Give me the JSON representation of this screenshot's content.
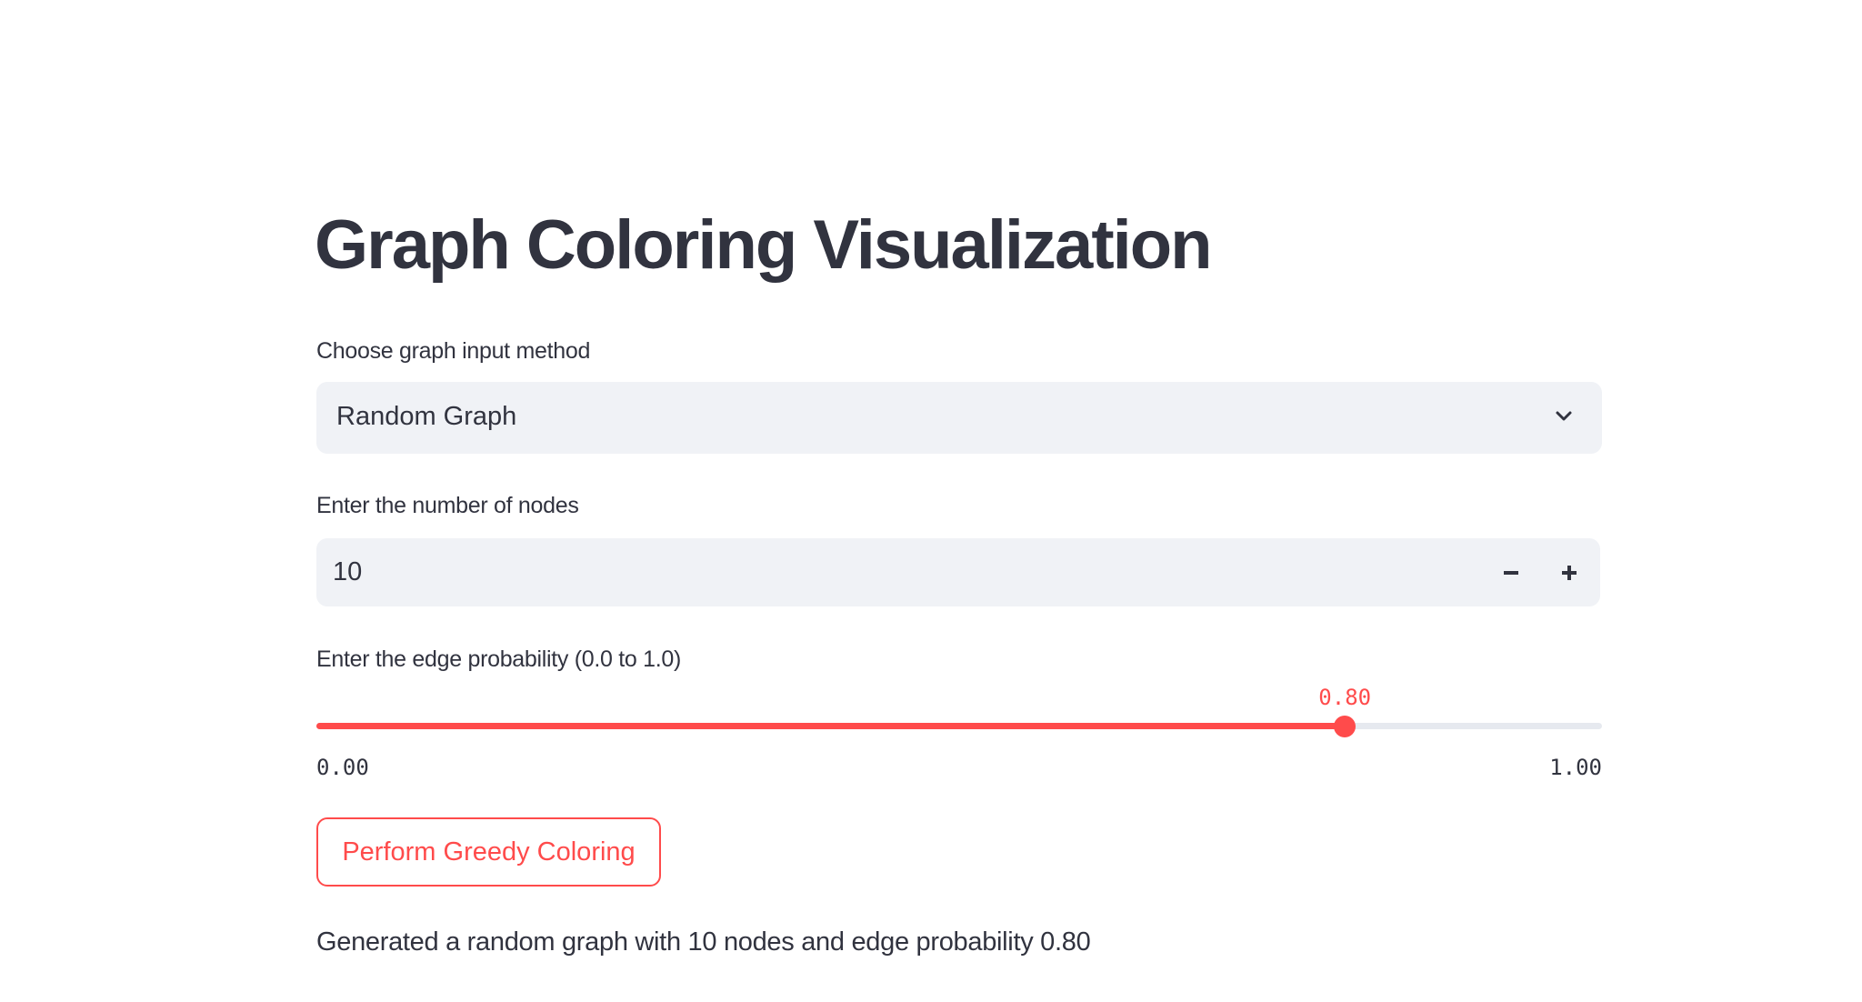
{
  "title": "Graph Coloring Visualization",
  "input_method": {
    "label": "Choose graph input method",
    "selected": "Random Graph"
  },
  "nodes": {
    "label": "Enter the number of nodes",
    "value": "10",
    "decrement": "−",
    "increment": "+"
  },
  "edge_prob": {
    "label": "Enter the edge probability (0.0 to 1.0)",
    "value": 0.8,
    "value_label": "0.80",
    "min_label": "0.00",
    "max_label": "1.00"
  },
  "button_label": "Perform Greedy Coloring",
  "message": "Generated a random graph with 10 nodes and edge probability 0.80",
  "colors": {
    "accent": "#ff4b4b",
    "text": "#31333f",
    "field_bg": "#f0f2f6"
  }
}
